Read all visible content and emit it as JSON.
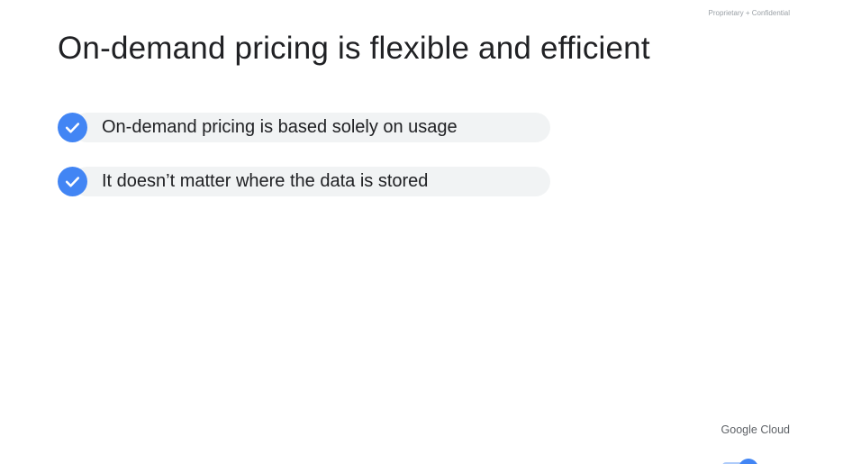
{
  "header": {
    "confidential_label": "Proprietary + Confidential"
  },
  "slide": {
    "title": "On-demand pricing is flexible and efficient",
    "bullets": [
      {
        "text": "On-demand pricing is based solely on usage",
        "icon": "check-circle-icon"
      },
      {
        "text": "It doesn’t matter where the data is stored",
        "icon": "check-circle-icon"
      }
    ]
  },
  "footer": {
    "logo_text": "Google Cloud"
  },
  "colors": {
    "accent": "#4285f4",
    "pill_background": "#f1f3f4",
    "title_text": "#202124",
    "muted_text": "#9aa0a6"
  }
}
